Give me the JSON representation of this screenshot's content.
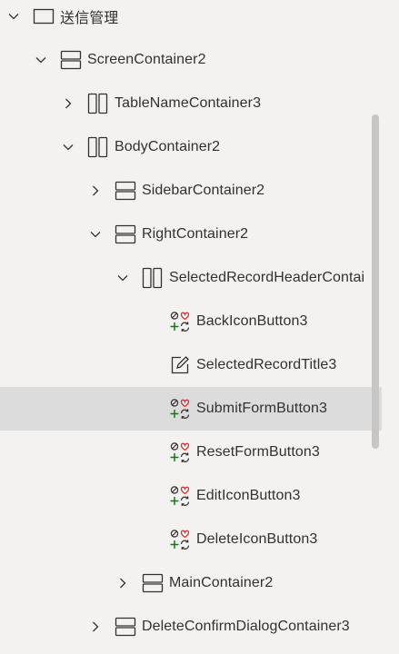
{
  "tree": {
    "items": [
      {
        "label": "送信管理",
        "icon": "screen-icon",
        "expand": "expanded"
      },
      {
        "label": "ScreenContainer2",
        "icon": "vertical-container-icon",
        "expand": "expanded"
      },
      {
        "label": "TableNameContainer3",
        "icon": "horizontal-container-icon",
        "expand": "collapsed"
      },
      {
        "label": "BodyContainer2",
        "icon": "horizontal-container-icon",
        "expand": "expanded"
      },
      {
        "label": "SidebarContainer2",
        "icon": "vertical-container-icon",
        "expand": "collapsed"
      },
      {
        "label": "RightContainer2",
        "icon": "vertical-container-icon",
        "expand": "expanded"
      },
      {
        "label": "SelectedRecordHeaderContai",
        "icon": "horizontal-container-icon",
        "expand": "expanded"
      },
      {
        "label": "BackIconButton3",
        "icon": "button-icon",
        "expand": "none"
      },
      {
        "label": "SelectedRecordTitle3",
        "icon": "label-edit-icon",
        "expand": "none"
      },
      {
        "label": "SubmitFormButton3",
        "icon": "button-icon",
        "expand": "none",
        "selected": true
      },
      {
        "label": "ResetFormButton3",
        "icon": "button-icon",
        "expand": "none"
      },
      {
        "label": "EditIconButton3",
        "icon": "button-icon",
        "expand": "none"
      },
      {
        "label": "DeleteIconButton3",
        "icon": "button-icon",
        "expand": "none"
      },
      {
        "label": "MainContainer2",
        "icon": "vertical-container-icon",
        "expand": "collapsed"
      },
      {
        "label": "DeleteConfirmDialogContainer3",
        "icon": "vertical-container-icon",
        "expand": "collapsed"
      }
    ]
  },
  "colors": {
    "background": "#f3f2f1",
    "selected_row": "#dcdcdc",
    "text": "#323130",
    "scrollbar_thumb": "#c8c6c4",
    "icon_red": "#d13438",
    "icon_green": "#107c10"
  }
}
